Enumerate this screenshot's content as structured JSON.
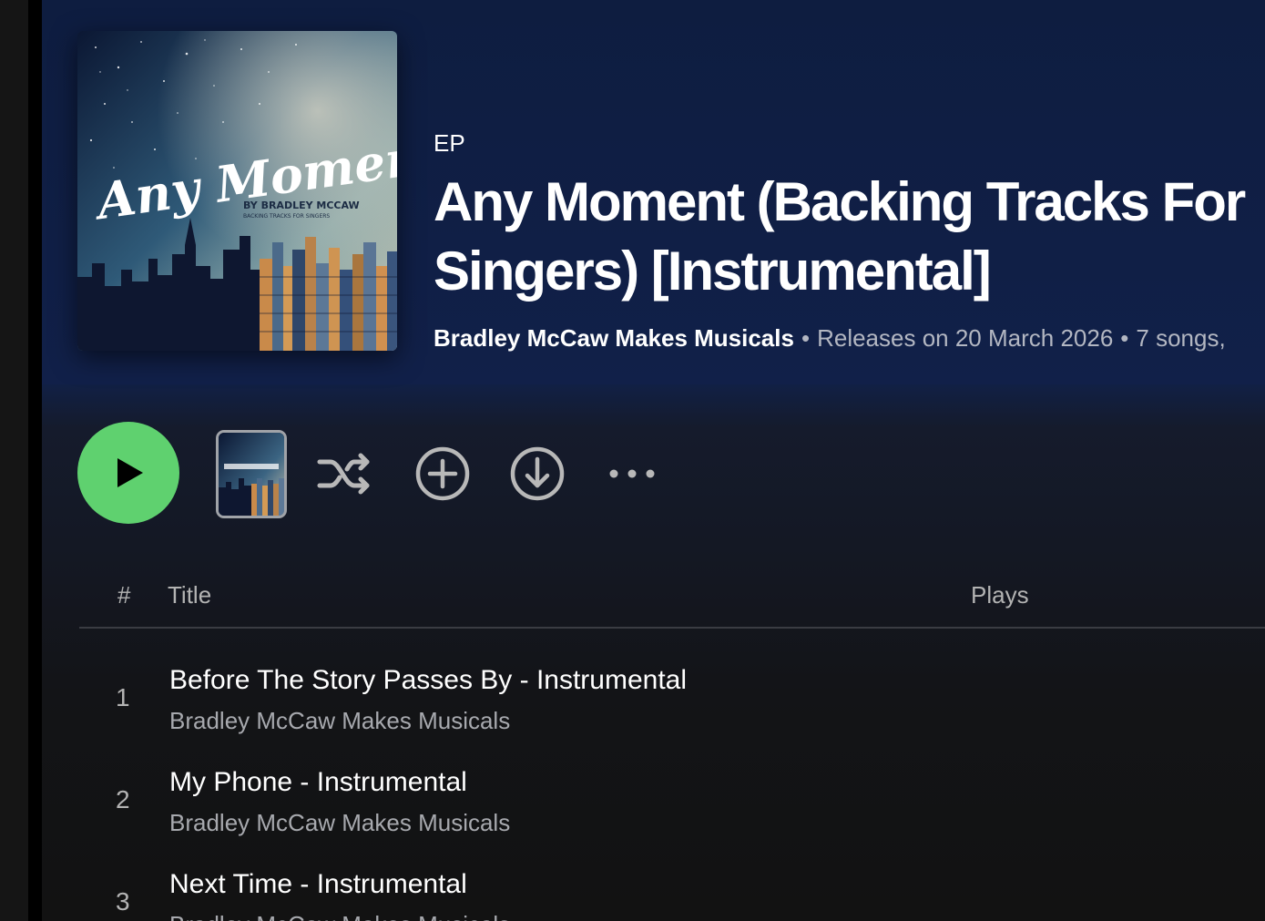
{
  "album": {
    "type_label": "EP",
    "title": "Any Moment (Backing Tracks For Singers) [Instrumental]",
    "artist": "Bradley McCaw Makes Musicals",
    "release_info": "Releases on 20 March 2026",
    "song_count": "7 songs,",
    "cover": {
      "script_text": "Any Moment.",
      "by_line": "BY BRADLEY MCCAW",
      "sub_line": "BACKING TRACKS FOR SINGERS"
    }
  },
  "actions": {
    "play_icon": "play-icon",
    "shuffle_icon": "shuffle-icon",
    "add_icon": "add-circle-icon",
    "download_icon": "download-icon",
    "more_icon": "more-horizontal-icon"
  },
  "table": {
    "header_num": "#",
    "header_title": "Title",
    "header_plays": "Plays"
  },
  "tracks": [
    {
      "number": "1",
      "title": "Before The Story Passes By - Instrumental",
      "artist": "Bradley McCaw Makes Musicals"
    },
    {
      "number": "2",
      "title": "My Phone - Instrumental",
      "artist": "Bradley McCaw Makes Musicals"
    },
    {
      "number": "3",
      "title": "Next Time - Instrumental",
      "artist": "Bradley McCaw Makes Musicals"
    }
  ],
  "colors": {
    "accent": "#5fd16f",
    "header_bg": "#112049",
    "text_muted": "#b3b3b3"
  }
}
